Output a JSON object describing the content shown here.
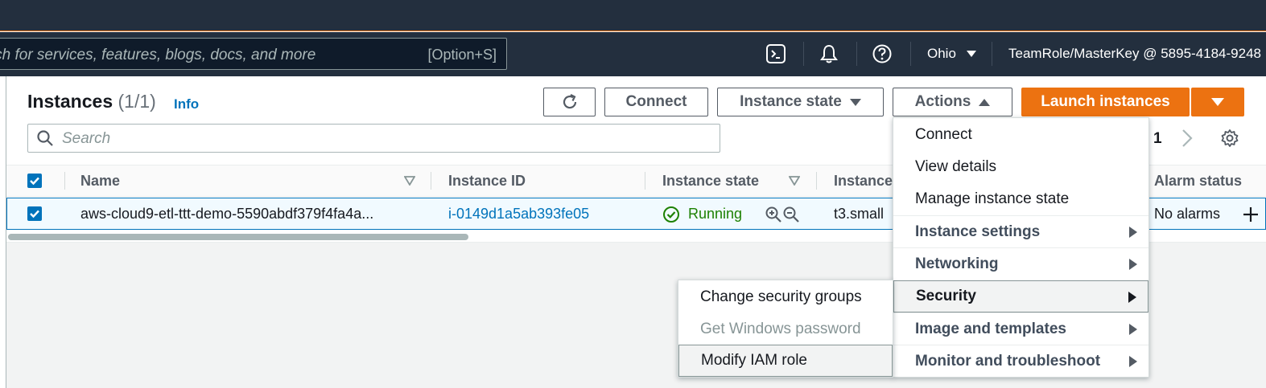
{
  "topbar": {
    "search_placeholder": "Search for services, features, blogs, docs, and more",
    "search_shortcut": "[Option+S]",
    "region": "Ohio",
    "account": "TeamRole/MasterKey @ 5895-4184-9248"
  },
  "header": {
    "title": "Instances",
    "count": "(1/1)",
    "info": "Info"
  },
  "toolbar": {
    "connect": "Connect",
    "instance_state": "Instance state",
    "actions": "Actions",
    "launch": "Launch instances"
  },
  "filter": {
    "placeholder": "Search"
  },
  "pagination": {
    "page": "1"
  },
  "table": {
    "columns": [
      "Name",
      "Instance ID",
      "Instance state",
      "Instance",
      "Alarm status"
    ],
    "row": {
      "name": "aws-cloud9-etl-ttt-demo-5590abdf379f4fa4a...",
      "instance_id": "i-0149d1a5ab393fe05",
      "state": "Running",
      "type": "t3.small",
      "alarm": "No alarms"
    }
  },
  "actions_menu": {
    "items": [
      {
        "label": "Connect"
      },
      {
        "label": "View details"
      },
      {
        "label": "Manage instance state"
      }
    ],
    "groups": [
      {
        "label": "Instance settings"
      },
      {
        "label": "Networking"
      },
      {
        "label": "Security",
        "highlighted": true
      },
      {
        "label": "Image and templates"
      },
      {
        "label": "Monitor and troubleshoot"
      }
    ]
  },
  "security_submenu": {
    "items": [
      {
        "label": "Change security groups"
      },
      {
        "label": "Get Windows password",
        "disabled": true
      },
      {
        "label": "Modify IAM role",
        "highlighted": true
      }
    ]
  },
  "colors": {
    "nav_bg": "#232f3e",
    "accent": "#ec7211",
    "link": "#0073bb",
    "running": "#1d8102"
  }
}
